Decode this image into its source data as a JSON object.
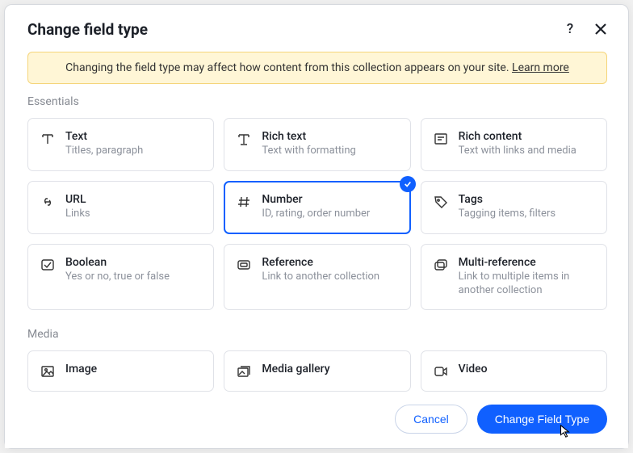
{
  "modal": {
    "title": "Change field type",
    "warning_text": "Changing the field type may affect how content from this collection appears on your site. ",
    "warning_link": "Learn more",
    "cancel_label": "Cancel",
    "submit_label": "Change Field Type"
  },
  "sections": {
    "essentials": {
      "label": "Essentials",
      "items": {
        "text": {
          "title": "Text",
          "sub": "Titles, paragraph"
        },
        "rich_text": {
          "title": "Rich text",
          "sub": "Text with formatting"
        },
        "rich_content": {
          "title": "Rich content",
          "sub": "Text with links and media"
        },
        "url": {
          "title": "URL",
          "sub": "Links"
        },
        "number": {
          "title": "Number",
          "sub": "ID, rating, order number"
        },
        "tags": {
          "title": "Tags",
          "sub": "Tagging items, filters"
        },
        "boolean": {
          "title": "Boolean",
          "sub": "Yes or no, true or false"
        },
        "reference": {
          "title": "Reference",
          "sub": "Link to another collection"
        },
        "multi_reference": {
          "title": "Multi-reference",
          "sub": "Link to multiple items in another collection"
        }
      }
    },
    "media": {
      "label": "Media",
      "items": {
        "image": {
          "title": "Image",
          "sub": ""
        },
        "media_gallery": {
          "title": "Media gallery",
          "sub": ""
        },
        "video": {
          "title": "Video",
          "sub": ""
        }
      }
    }
  },
  "selected": "number"
}
